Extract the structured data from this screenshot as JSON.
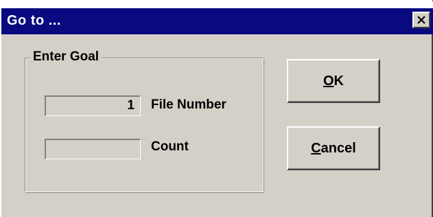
{
  "window": {
    "title": "Go to ...",
    "close_icon": "close-icon"
  },
  "group": {
    "legend": "Enter Goal",
    "file_number": {
      "value": "1",
      "label": "File Number"
    },
    "count": {
      "value": "",
      "label": "Count"
    }
  },
  "buttons": {
    "ok": {
      "mnemonic": "O",
      "rest": "K"
    },
    "cancel": {
      "mnemonic": "C",
      "rest": "ancel"
    }
  },
  "colors": {
    "titlebar": "#0a0a80",
    "face": "#d4d0c8"
  }
}
